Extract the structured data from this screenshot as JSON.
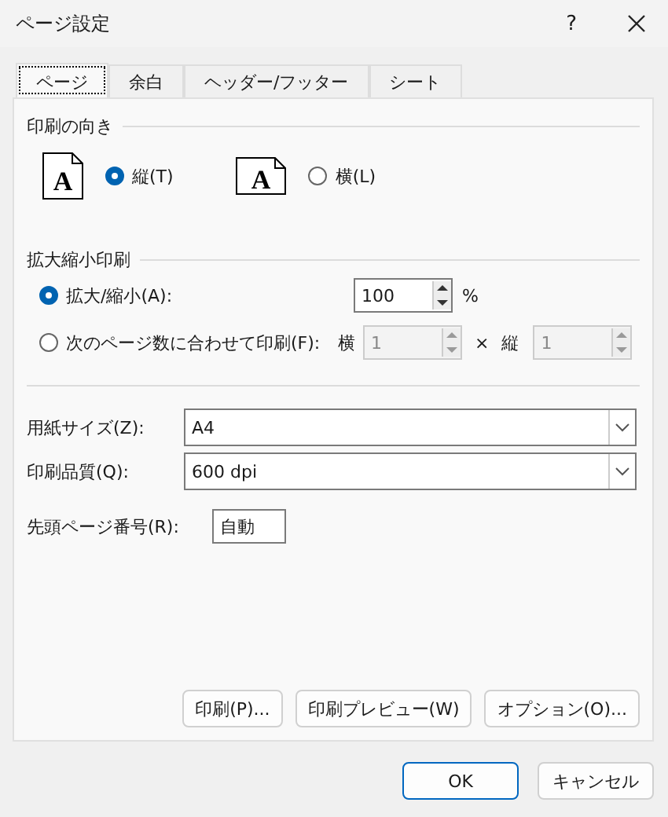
{
  "window": {
    "title": "ページ設定",
    "help": "?"
  },
  "tabs": [
    {
      "label": "ページ",
      "selected": true
    },
    {
      "label": "余白",
      "selected": false
    },
    {
      "label": "ヘッダー/フッター",
      "selected": false
    },
    {
      "label": "シート",
      "selected": false
    }
  ],
  "orientation": {
    "title": "印刷の向き",
    "options": [
      {
        "kind": "portrait",
        "icon_text": "A",
        "label": "縦(T)",
        "selected": true
      },
      {
        "kind": "landscape",
        "icon_text": "A",
        "label": "横(L)",
        "selected": false
      }
    ]
  },
  "scaling": {
    "title": "拡大縮小印刷",
    "options": [
      {
        "kind": "percent",
        "label": "拡大/縮小(A):",
        "selected": true,
        "value": "100",
        "unit": "%",
        "disabled": false
      },
      {
        "kind": "fit",
        "label": "次のページ数に合わせて印刷(F):",
        "selected": false,
        "wide_label": "横",
        "wide_value": "1",
        "times": "×",
        "tall_label": "縦",
        "tall_value": "1",
        "disabled": true
      }
    ]
  },
  "paper_size": {
    "label": "用紙サイズ(Z):",
    "value": "A4"
  },
  "print_quality": {
    "label": "印刷品質(Q):",
    "value": "600 dpi"
  },
  "first_page_number": {
    "label": "先頭ページ番号(R):",
    "value": "自動"
  },
  "panel_buttons": [
    "印刷(P)...",
    "印刷プレビュー(W)",
    "オプション(O)..."
  ],
  "dialog_buttons": [
    {
      "label": "OK",
      "default": true
    },
    {
      "label": "キャンセル",
      "default": false
    }
  ]
}
